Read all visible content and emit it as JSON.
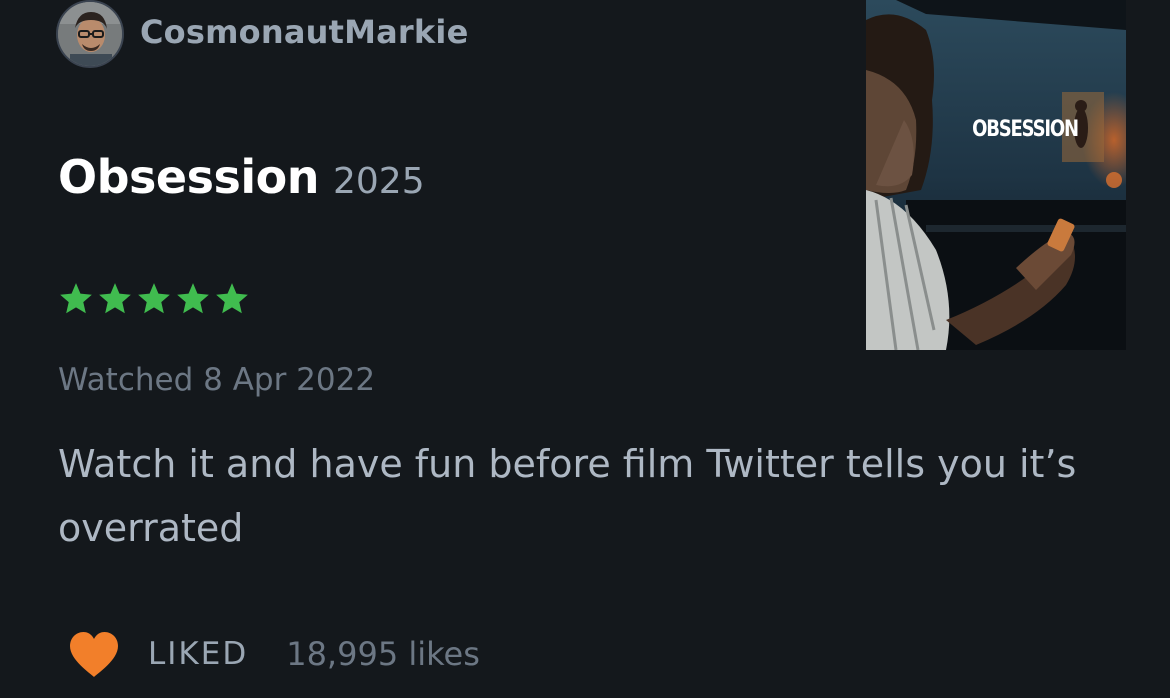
{
  "review": {
    "author": {
      "name": "CosmonautMarkie",
      "avatar_icon": "user-avatar"
    },
    "film": {
      "title": "Obsession",
      "year": "2025",
      "poster_title": "OBSESSION"
    },
    "rating": {
      "stars": 5,
      "max": 5,
      "star_color": "#40bc4f",
      "star_icon": "star-icon"
    },
    "watched_text": "Watched 8 Apr 2022",
    "body": "Watch it and have fun before film Twitter tells you it’s overrated",
    "liked": {
      "label": "LIKED",
      "heart_icon": "heart-icon",
      "heart_color": "#f27f2a",
      "likes_text": "18,995 likes"
    }
  },
  "colors": {
    "background": "#14181c",
    "title": "#ffffff",
    "muted": "#9aa6b3",
    "dim": "#6c7784"
  }
}
